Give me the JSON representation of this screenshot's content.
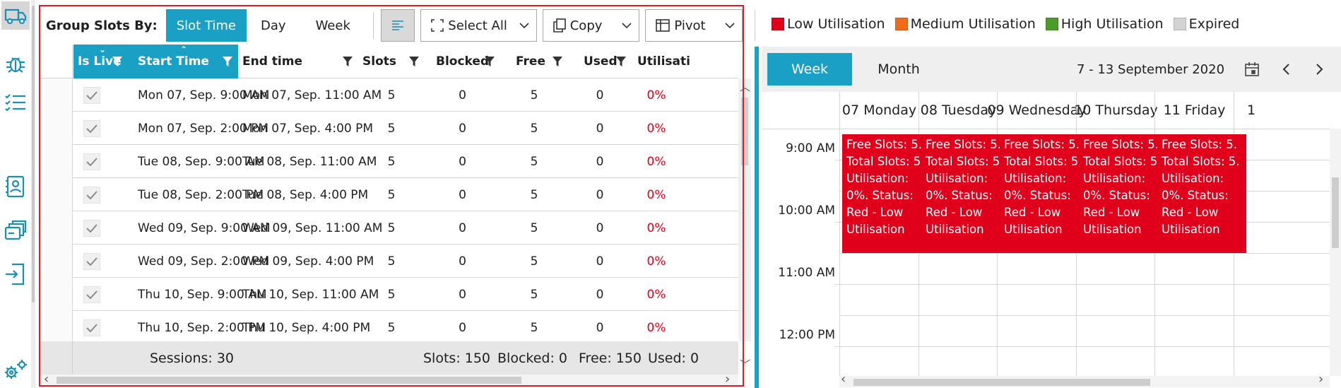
{
  "toolbar": {
    "group_label": "Group Slots By:",
    "group_options": [
      "Slot Time",
      "Day",
      "Week"
    ],
    "group_selected": "Slot Time",
    "select_all_label": "Select All",
    "copy_label": "Copy",
    "pivot_label": "Pivot"
  },
  "legend": [
    {
      "label": "Low Utilisation",
      "color": "#e0001b"
    },
    {
      "label": "Medium Utilisation",
      "color": "#ec6b1c"
    },
    {
      "label": "High Utilisation",
      "color": "#4c9a2a"
    },
    {
      "label": "Expired",
      "color": "#d3d3d3"
    }
  ],
  "grid": {
    "columns": [
      "Is Live",
      "Start Time",
      "End time",
      "Slots",
      "Blocked",
      "Free",
      "Used",
      "Utilisati"
    ],
    "rows": [
      {
        "start": "Mon 07, Sep. 9:00 AM",
        "end": "Mon 07, Sep. 11:00 AM",
        "slots": "5",
        "blocked": "0",
        "free": "5",
        "used": "0",
        "util": "0%"
      },
      {
        "start": "Mon 07, Sep. 2:00 PM",
        "end": "Mon 07, Sep. 4:00 PM",
        "slots": "5",
        "blocked": "0",
        "free": "5",
        "used": "0",
        "util": "0%"
      },
      {
        "start": "Tue 08, Sep. 9:00 AM",
        "end": "Tue 08, Sep. 11:00 AM",
        "slots": "5",
        "blocked": "0",
        "free": "5",
        "used": "0",
        "util": "0%"
      },
      {
        "start": "Tue 08, Sep. 2:00 PM",
        "end": "Tue 08, Sep. 4:00 PM",
        "slots": "5",
        "blocked": "0",
        "free": "5",
        "used": "0",
        "util": "0%"
      },
      {
        "start": "Wed 09, Sep. 9:00 AM",
        "end": "Wed 09, Sep. 11:00 AM",
        "slots": "5",
        "blocked": "0",
        "free": "5",
        "used": "0",
        "util": "0%"
      },
      {
        "start": "Wed 09, Sep. 2:00 PM",
        "end": "Wed 09, Sep. 4:00 PM",
        "slots": "5",
        "blocked": "0",
        "free": "5",
        "used": "0",
        "util": "0%"
      },
      {
        "start": "Thu 10, Sep. 9:00 AM",
        "end": "Thu 10, Sep. 11:00 AM",
        "slots": "5",
        "blocked": "0",
        "free": "5",
        "used": "0",
        "util": "0%"
      },
      {
        "start": "Thu 10, Sep. 2:00 PM",
        "end": "Thu 10, Sep. 4:00 PM",
        "slots": "5",
        "blocked": "0",
        "free": "5",
        "used": "0",
        "util": "0%"
      }
    ],
    "footer": {
      "sessions": "Sessions: 30",
      "slots": "Slots: 150",
      "blocked": "Blocked: 0",
      "free": "Free: 150",
      "used": "Used: 0"
    }
  },
  "calendar": {
    "tabs": [
      "Week",
      "Month"
    ],
    "active_tab": "Week",
    "range": "7  - 13 September 2020",
    "days": [
      "07 Monday",
      "08 Tuesday",
      "09 Wednesday",
      "10 Thursday",
      "11 Friday",
      "1"
    ],
    "times": [
      "9:00 AM",
      "10:00 AM",
      "11:00 AM",
      "12:00 PM"
    ],
    "event_text": "Free Slots: 5. Total Slots: 5. Utilisation: 0%. Status: Red - Low Utilisation",
    "event_color": "#e0001b"
  },
  "colors": {
    "accent": "#1aa0c4",
    "frame": "#d51f2a"
  },
  "icons": {
    "rail": [
      "truck-icon",
      "bug-icon",
      "checklist-icon",
      "contact-card-icon",
      "stacked-cards-icon",
      "login-arrow-icon",
      "gears-icon"
    ]
  }
}
